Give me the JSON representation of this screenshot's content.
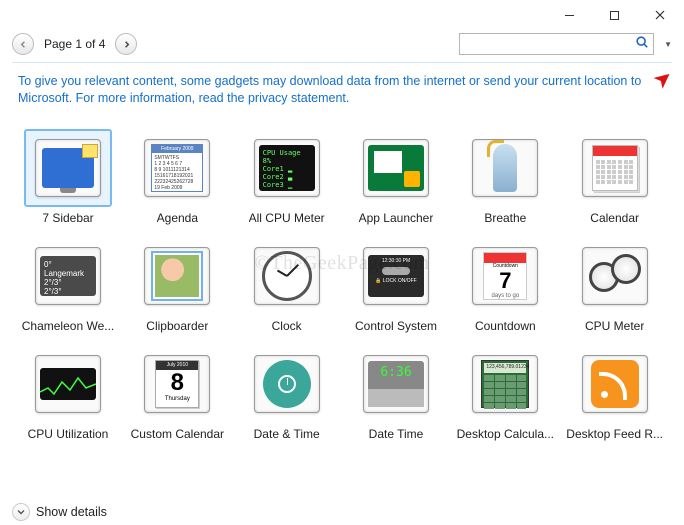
{
  "window": {
    "minimize": "–",
    "maximize": "□",
    "close": "×"
  },
  "pager": {
    "label": "Page 1 of 4"
  },
  "search": {
    "placeholder": ""
  },
  "notice": {
    "text_prefix": "To give you relevant content, some gadgets may download data from the internet or send your current location to Microsoft. For more information, read the ",
    "link": "privacy statement",
    "text_suffix": "."
  },
  "gadgets": [
    {
      "label": "7 Sidebar",
      "icon": "sidebar",
      "selected": true
    },
    {
      "label": "Agenda",
      "icon": "agenda",
      "selected": false
    },
    {
      "label": "All CPU Meter",
      "icon": "allcpu",
      "selected": false
    },
    {
      "label": "App Launcher",
      "icon": "applaunch",
      "selected": false
    },
    {
      "label": "Breathe",
      "icon": "breathe",
      "selected": false
    },
    {
      "label": "Calendar",
      "icon": "calendar",
      "selected": false
    },
    {
      "label": "Chameleon We...",
      "icon": "weather",
      "selected": false
    },
    {
      "label": "Clipboarder",
      "icon": "clipboard",
      "selected": false
    },
    {
      "label": "Clock",
      "icon": "clock",
      "selected": false
    },
    {
      "label": "Control System",
      "icon": "control",
      "selected": false
    },
    {
      "label": "Countdown",
      "icon": "countdown",
      "selected": false
    },
    {
      "label": "CPU Meter",
      "icon": "cpumeter",
      "selected": false
    },
    {
      "label": "CPU Utilization",
      "icon": "cpuutil",
      "selected": false
    },
    {
      "label": "Custom Calendar",
      "icon": "customcal",
      "selected": false
    },
    {
      "label": "Date & Time",
      "icon": "datetime",
      "selected": false
    },
    {
      "label": "Date Time",
      "icon": "datetime2",
      "selected": false
    },
    {
      "label": "Desktop Calcula...",
      "icon": "calc",
      "selected": false
    },
    {
      "label": "Desktop Feed R...",
      "icon": "rss",
      "selected": false
    }
  ],
  "icon_text": {
    "agenda_header": "February 2009",
    "allcpu": "CPU Usage  8%",
    "weather": "0° Langemark",
    "control_time": "12:30:30 PM",
    "control_lock": "LOCK ON/OFF",
    "countdown_top": "Countdown",
    "countdown_num": "7",
    "countdown_days": "days to go",
    "customcal_top": "July 2010",
    "customcal_num": "8",
    "customcal_day": "Thursday",
    "datetime2": "6:36",
    "calc_screen": "123,456,789.01234"
  },
  "footer": {
    "label": "Show details"
  },
  "watermark": "©TheGeekPage.com"
}
